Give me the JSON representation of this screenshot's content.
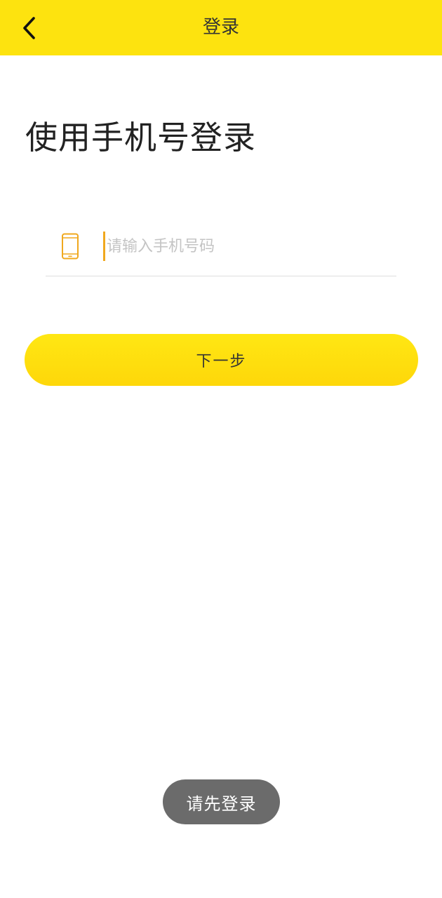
{
  "app_bar": {
    "title": "登录",
    "back_icon": "chevron-left-icon",
    "background_color": "#fde30f"
  },
  "main": {
    "heading": "使用手机号登录",
    "phone_field": {
      "icon": "mobile-phone-icon",
      "icon_color": "#f0a81e",
      "value": "",
      "placeholder": "请输入手机号码"
    },
    "next_button": {
      "label": "下一步",
      "color": "#fed70a"
    }
  },
  "toast": {
    "message": "请先登录"
  }
}
